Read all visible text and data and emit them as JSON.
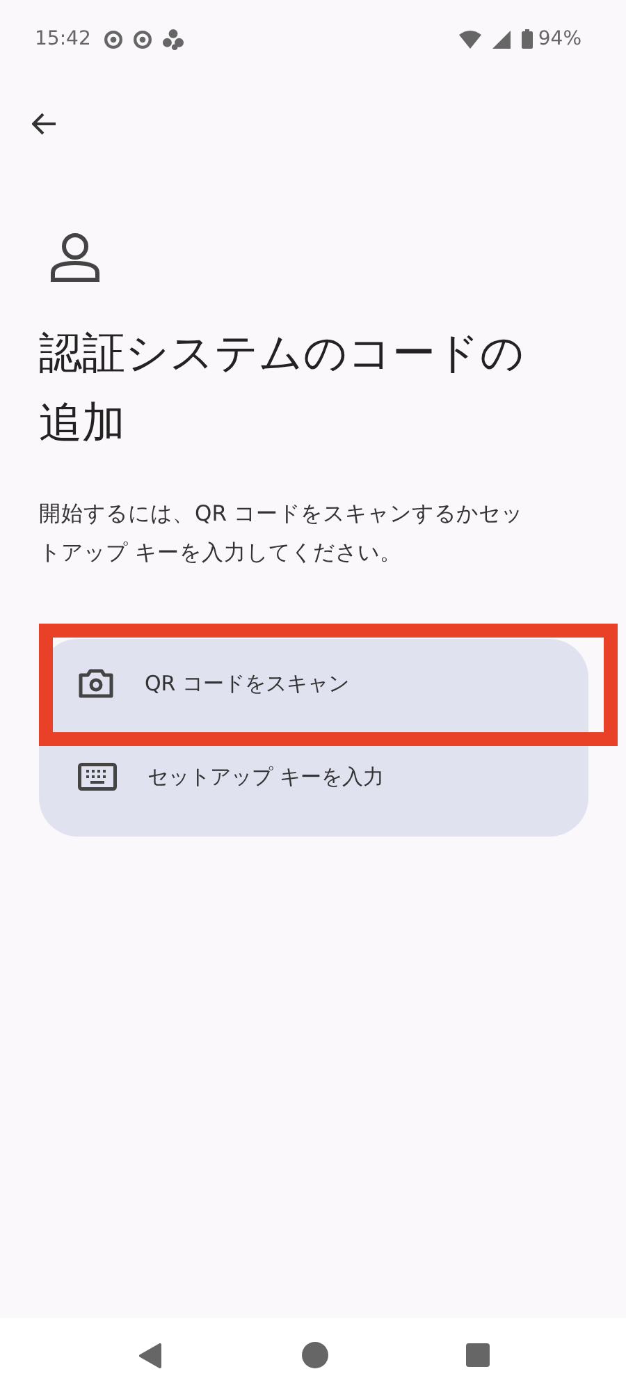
{
  "status_bar": {
    "time": "15:42",
    "battery": "94%"
  },
  "title": "認証システムのコードの追加",
  "description": "開始するには、QR コードをスキャンするかセットアップ キーを入力してください。",
  "options": [
    {
      "kind": "camera",
      "label": "QR コードをスキャン",
      "highlighted": true
    },
    {
      "kind": "keyboard",
      "label": "セットアップ キーを入力",
      "highlighted": false
    }
  ]
}
